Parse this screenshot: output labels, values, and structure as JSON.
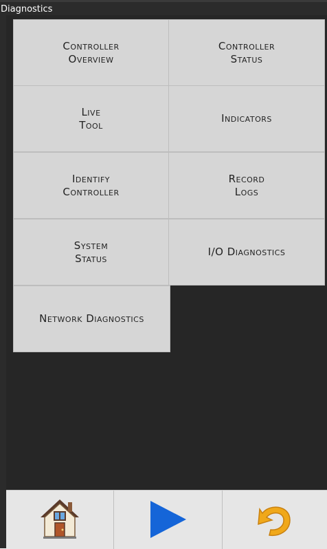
{
  "window": {
    "title": "Diagnostics"
  },
  "tiles": [
    {
      "label": "Controller\nOverview"
    },
    {
      "label": "Controller\nStatus"
    },
    {
      "label": "Live\nTool"
    },
    {
      "label": "Indicators"
    },
    {
      "label": "Identify\nController"
    },
    {
      "label": "Record\nLogs"
    },
    {
      "label": "System\nStatus"
    },
    {
      "label": "I/O Diagnostics"
    },
    {
      "label": "Network Diagnostics"
    }
  ],
  "toolbar": {
    "home_icon": "home-icon",
    "play_icon": "play-icon",
    "back_icon": "undo-icon"
  },
  "colors": {
    "background": "#2b2b2b",
    "tile": "#d6d6d6",
    "toolbar": "#e6e6e6",
    "play": "#1565d8",
    "undo": "#f0a81a"
  }
}
